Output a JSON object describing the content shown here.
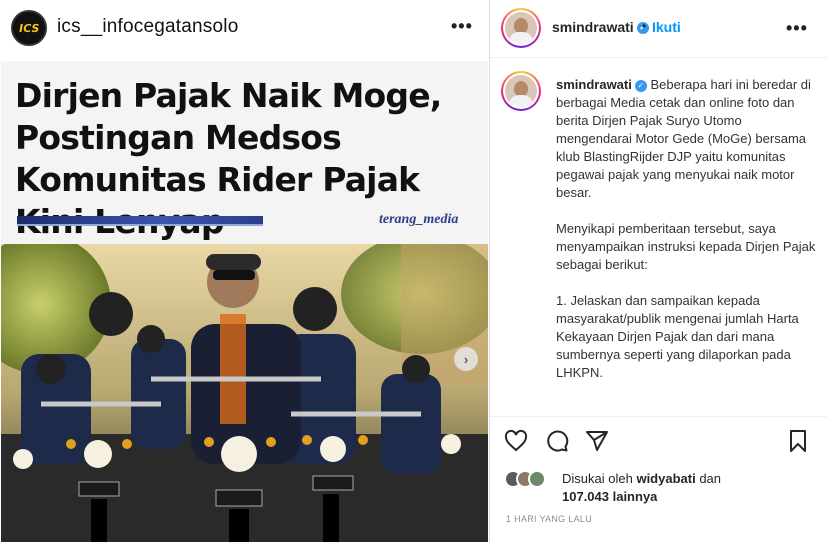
{
  "left_header": {
    "logo_text": "ICS",
    "account_name": "ics__infocegatansolo",
    "more": "•••"
  },
  "post_image": {
    "headline": "Dirjen Pajak Naik Moge, Postingan Medsos Komunitas Rider Pajak Kini Lenyap",
    "source": "terang_media",
    "next_arrow": "›"
  },
  "right_header": {
    "username": "smindrawati",
    "separator": "•",
    "follow_label": "Ikuti",
    "more": "•••"
  },
  "caption": {
    "username": "smindrawati",
    "text": "Beberapa hari ini beredar di berbagai Media cetak dan online foto dan berita Dirjen Pajak Suryo Utomo mengendarai Motor Gede (MoGe) bersama klub BlastingRijder DJP yaitu komunitas pegawai pajak yang menyukai naik motor besar.\n\nMenyikapi pemberitaan tersebut, saya menyampaikan instruksi kepada Dirjen Pajak sebagai berikut:\n\n1. Jelaskan dan sampaikan kepada masyarakat/publik mengenai jumlah Harta Kekayaan Dirjen Pajak dan dari mana sumbernya seperti yang dilaporkan pada LHKPN."
  },
  "likes": {
    "prefix": "Disukai oleh",
    "user": "widyabati",
    "conj": "dan",
    "count": "107.043 lainnya"
  },
  "timestamp": "1 HARI YANG LALU",
  "colors": {
    "link_blue": "#0095f6",
    "verified_blue": "#3897f0"
  }
}
